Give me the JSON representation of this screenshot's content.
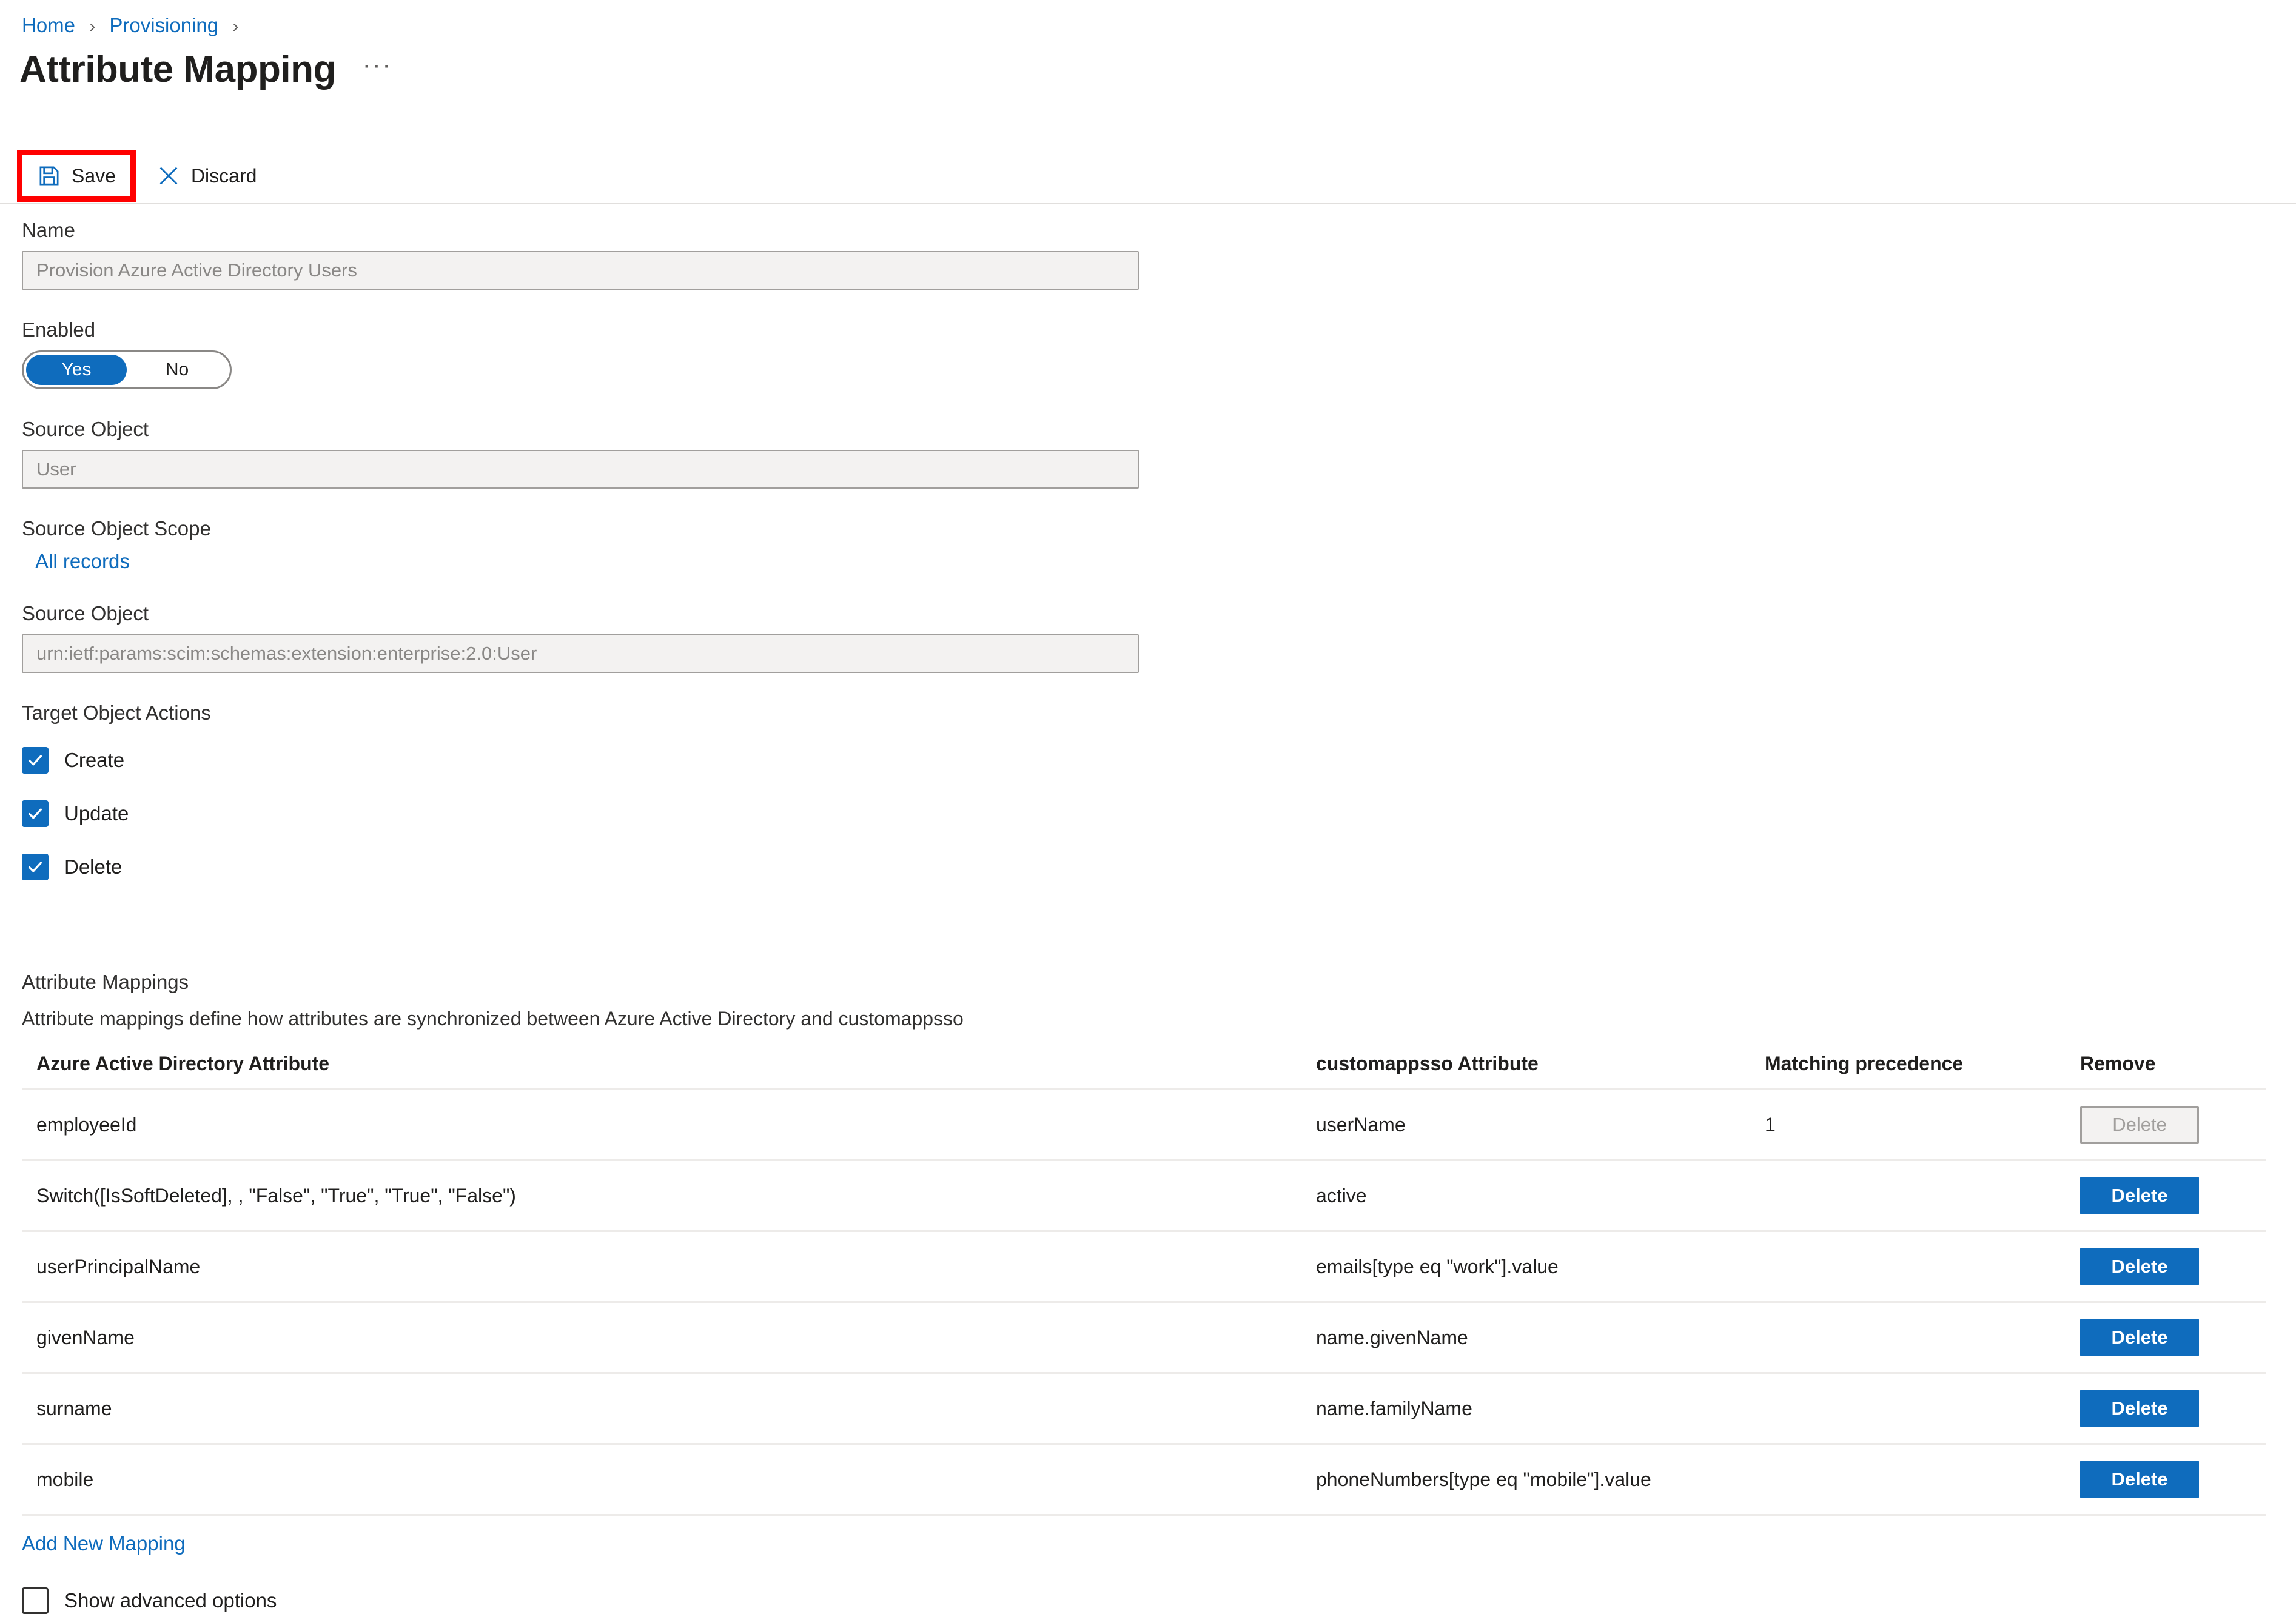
{
  "breadcrumb": {
    "items": [
      {
        "label": "Home",
        "icon": ""
      },
      {
        "label": "Provisioning",
        "icon": ""
      }
    ],
    "separator": "›",
    "trailing_separator": "›"
  },
  "header": {
    "title": "Attribute Mapping",
    "overflow_icon": "ellipsis-icon",
    "overflow_label": "···"
  },
  "command_bar": {
    "save_label": "Save",
    "save_icon": "save-floppy-icon",
    "discard_label": "Discard",
    "discard_icon": "close-x-icon",
    "highlight_color": "#ff0000",
    "accent_color": "#0f6cbd"
  },
  "form": {
    "name": {
      "label": "Name",
      "value": "Provision Azure Active Directory Users"
    },
    "enabled": {
      "label": "Enabled",
      "options": [
        "Yes",
        "No"
      ],
      "selected": "Yes"
    },
    "source_object": {
      "label": "Source Object",
      "value": "User"
    },
    "source_object_scope": {
      "label": "Source Object Scope",
      "link_label": "All records"
    },
    "source_object_schema": {
      "label": "Source Object",
      "value": "urn:ietf:params:scim:schemas:extension:enterprise:2.0:User"
    },
    "target_object_actions": {
      "label": "Target Object Actions",
      "items": [
        {
          "label": "Create",
          "checked": true
        },
        {
          "label": "Update",
          "checked": true
        },
        {
          "label": "Delete",
          "checked": true
        }
      ]
    }
  },
  "mappings": {
    "title": "Attribute Mappings",
    "description": "Attribute mappings define how attributes are synchronized between Azure Active Directory and customappsso",
    "columns": [
      "Azure Active Directory Attribute",
      "customappsso Attribute",
      "Matching precedence",
      "Remove"
    ],
    "rows": [
      {
        "aad_attribute": "employeeId",
        "customappsso_attribute": "userName",
        "matching_precedence": "1",
        "remove_label": "Delete",
        "remove_disabled": true
      },
      {
        "aad_attribute": "Switch([IsSoftDeleted], , \"False\", \"True\", \"True\", \"False\")",
        "customappsso_attribute": "active",
        "matching_precedence": "",
        "remove_label": "Delete",
        "remove_disabled": false
      },
      {
        "aad_attribute": "userPrincipalName",
        "customappsso_attribute": "emails[type eq \"work\"].value",
        "matching_precedence": "",
        "remove_label": "Delete",
        "remove_disabled": false
      },
      {
        "aad_attribute": "givenName",
        "customappsso_attribute": "name.givenName",
        "matching_precedence": "",
        "remove_label": "Delete",
        "remove_disabled": false
      },
      {
        "aad_attribute": "surname",
        "customappsso_attribute": "name.familyName",
        "matching_precedence": "",
        "remove_label": "Delete",
        "remove_disabled": false
      },
      {
        "aad_attribute": "mobile",
        "customappsso_attribute": "phoneNumbers[type eq \"mobile\"].value",
        "matching_precedence": "",
        "remove_label": "Delete",
        "remove_disabled": false
      }
    ],
    "add_new_label": "Add New Mapping",
    "advanced_options": {
      "label": "Show advanced options",
      "checked": false
    }
  }
}
